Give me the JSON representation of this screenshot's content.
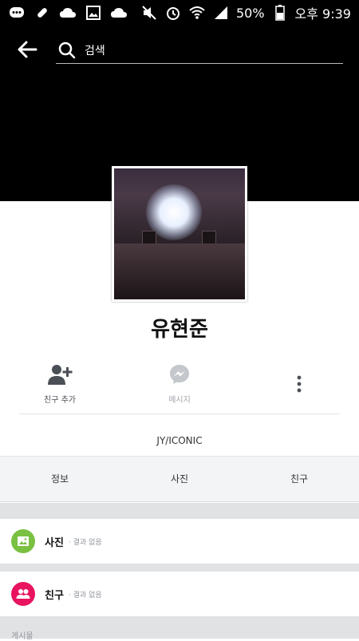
{
  "status_bar": {
    "battery": "50%",
    "time": "오후 9:39",
    "icons": [
      "chat-icon",
      "pill-icon",
      "cloud-icon",
      "gallery-icon",
      "cloud-icon",
      "mute-icon",
      "alarm-icon",
      "wifi-icon",
      "signal-icon",
      "battery-icon"
    ]
  },
  "search": {
    "placeholder": "검색"
  },
  "profile": {
    "name": "유현준",
    "bio": "JY/ICONIC"
  },
  "actions": [
    {
      "label": "친구 추가",
      "icon": "add-friend-icon"
    },
    {
      "label": "메시지",
      "icon": "messenger-icon"
    },
    {
      "icon": "more-vertical-icon"
    }
  ],
  "tabs": [
    {
      "label": "정보"
    },
    {
      "label": "사진"
    },
    {
      "label": "친구"
    }
  ],
  "sections": [
    {
      "title": "사진",
      "sub": "· 결과 없음",
      "icon": "photo-icon",
      "color": "#7ac142"
    },
    {
      "title": "친구",
      "sub": "· 결과 없음",
      "icon": "friends-icon",
      "color": "#e8145f"
    }
  ],
  "posts_label": "게시물"
}
